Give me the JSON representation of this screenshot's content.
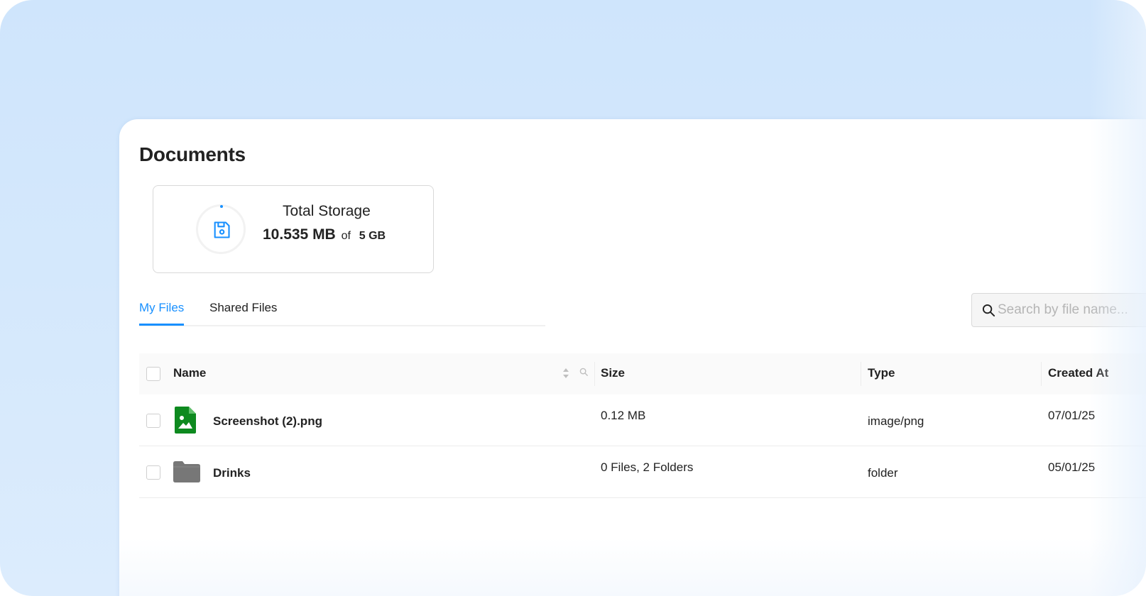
{
  "page": {
    "title": "Documents"
  },
  "storage": {
    "label": "Total Storage",
    "used": "10.535 MB",
    "of": "of",
    "total": "5 GB",
    "icon": "floppy-disk-icon",
    "accent_color": "#1890ff"
  },
  "tabs": [
    {
      "label": "My Files",
      "active": true
    },
    {
      "label": "Shared Files",
      "active": false
    }
  ],
  "search": {
    "placeholder": "Search by file name..."
  },
  "table": {
    "columns": [
      "Name",
      "Size",
      "Type",
      "Created At"
    ],
    "rows": [
      {
        "name": "Screenshot (2).png",
        "size": "0.12 MB",
        "type": "image/png",
        "created": "07/01/25",
        "icon": "image-file-icon"
      },
      {
        "name": "Drinks",
        "size": "0 Files, 2 Folders",
        "type": "folder",
        "created": "05/01/25",
        "icon": "folder-icon"
      }
    ]
  }
}
